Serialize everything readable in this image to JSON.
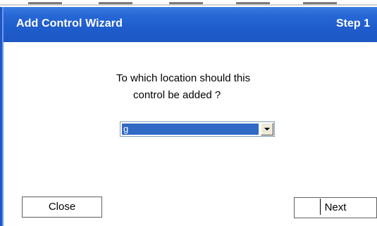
{
  "wizard": {
    "title": "Add Control  Wizard",
    "step": "Step 1"
  },
  "question": {
    "line1": "To which location should this",
    "line2": "control be added ?"
  },
  "location_select": {
    "value": "g"
  },
  "buttons": {
    "close": "Close",
    "next": "Next"
  },
  "colors": {
    "titlebar": "#1f5ccc",
    "selection": "#316ac5"
  }
}
